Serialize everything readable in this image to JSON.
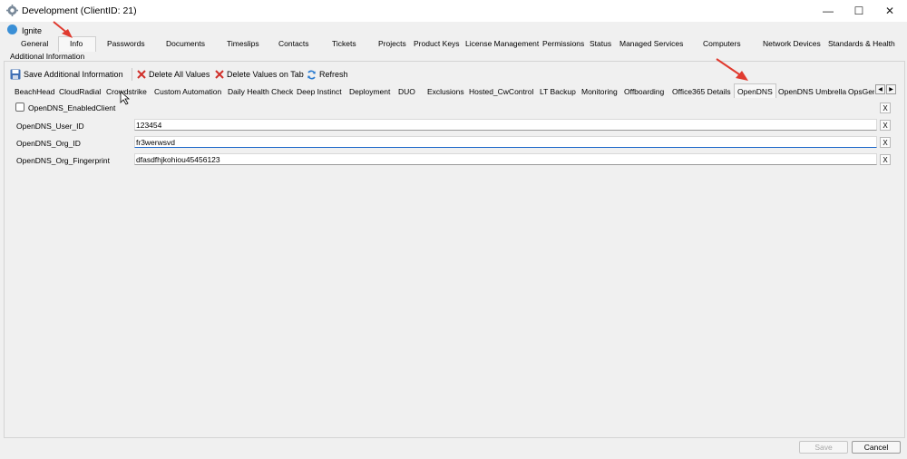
{
  "window": {
    "title": "Development  (ClientID: 21)",
    "controls": {
      "minimize": "—",
      "maximize": "☐",
      "close": "✕"
    }
  },
  "ignite_label": "Ignite",
  "top_tabs": [
    "General",
    "Info",
    "Passwords",
    "Documents",
    "Timeslips",
    "Contacts",
    "Tickets",
    "Projects",
    "Product Keys",
    "License Management",
    "Permissions",
    "Status",
    "Managed Services",
    "Computers",
    "Network Devices",
    "Standards & Health"
  ],
  "active_top_tab": "Info",
  "section_title": "Additional Information",
  "toolbar": {
    "save_label": "Save Additional Information",
    "delete_all_label": "Delete All Values",
    "delete_tab_label": "Delete Values on Tab",
    "refresh_label": "Refresh"
  },
  "sub_tabs": [
    "BeachHead",
    "CloudRadial",
    "Crowdstrike",
    "Custom Automation",
    "Daily Health Check",
    "Deep Instinct",
    "Deployment",
    "DUO",
    "Exclusions",
    "Hosted_CwControl",
    "LT Backup",
    "Monitoring",
    "Offboarding",
    "Office365 Details",
    "OpenDNS",
    "OpenDNS Umbrella",
    "OpsGen"
  ],
  "active_sub_tab": "OpenDNS",
  "checkbox": {
    "label": "OpenDNS_EnabledClient",
    "checked": false
  },
  "fields": [
    {
      "label": "OpenDNS_User_ID",
      "value": "123454"
    },
    {
      "label": "OpenDNS_Org_ID",
      "value": "fr3werwsvd"
    },
    {
      "label": "OpenDNS_Org_Fingerprint",
      "value": "dfasdfhjkohiou45456123"
    }
  ],
  "clear_label": "X",
  "buttons": {
    "save": "Save",
    "cancel": "Cancel"
  },
  "colors": {
    "arrow": "#e03a2f",
    "accent": "#1a66c9"
  }
}
